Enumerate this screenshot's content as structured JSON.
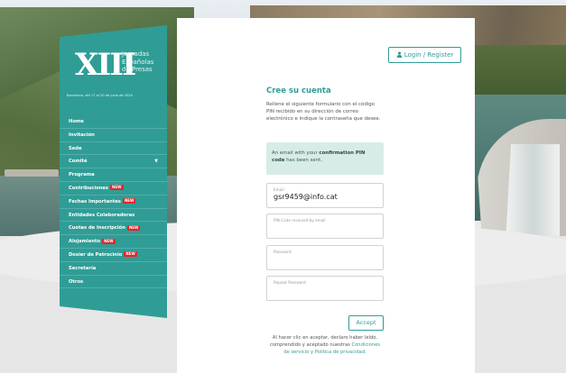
{
  "colors": {
    "accent": "#2f9d96",
    "new_badge": "#e3262b",
    "alert_bg": "#d8ece7"
  },
  "logo": {
    "numeral": "XIII",
    "line1": "Jornadas",
    "line2": "Españolas",
    "line3": "de Presas",
    "date": "Barcelona, del 17 al 20 de junio de 2024"
  },
  "nav": {
    "items": [
      {
        "label": "Home",
        "badge": ""
      },
      {
        "label": "Invitación",
        "badge": ""
      },
      {
        "label": "Sede",
        "badge": ""
      },
      {
        "label": "Comité",
        "badge": "",
        "dropdown": true
      },
      {
        "label": "Programa",
        "badge": ""
      },
      {
        "label": "Contribuciones",
        "badge": "NEW"
      },
      {
        "label": "Fechas Importantes",
        "badge": "NEW"
      },
      {
        "label": "Entidades Colaboradoras",
        "badge": ""
      },
      {
        "label": "Cuotas de Inscripción",
        "badge": "NEW"
      },
      {
        "label": "Alojamiento",
        "badge": "NEW"
      },
      {
        "label": "Dosier de Patrocinio",
        "badge": "NEW"
      },
      {
        "label": "Secretaría",
        "badge": ""
      },
      {
        "label": "Otros",
        "badge": ""
      }
    ]
  },
  "header": {
    "login_label": "Login / Register",
    "login_icon": "user-icon"
  },
  "form": {
    "title": "Cree su cuenta",
    "intro": "Rellene el siguiente formulario con el código PIN recibido en su dirección de correo electrónico e indique la contraseña que desee.",
    "alert_prefix": "An email with your",
    "alert_bold": "confirmation PIN code",
    "alert_suffix": "has been sent.",
    "email_label": "Email",
    "email_value": "gsr9459@info.cat",
    "pin_placeholder": "PIN Code received by email",
    "password_placeholder": "Password",
    "repeat_placeholder": "Repeat Password",
    "accept_label": "Accept",
    "terms_text": "Al hacer clic en aceptar, declaro haber leído, comprendido y aceptado nuestras",
    "terms_link": "Condiciones de servicio y Política de privacidad."
  }
}
